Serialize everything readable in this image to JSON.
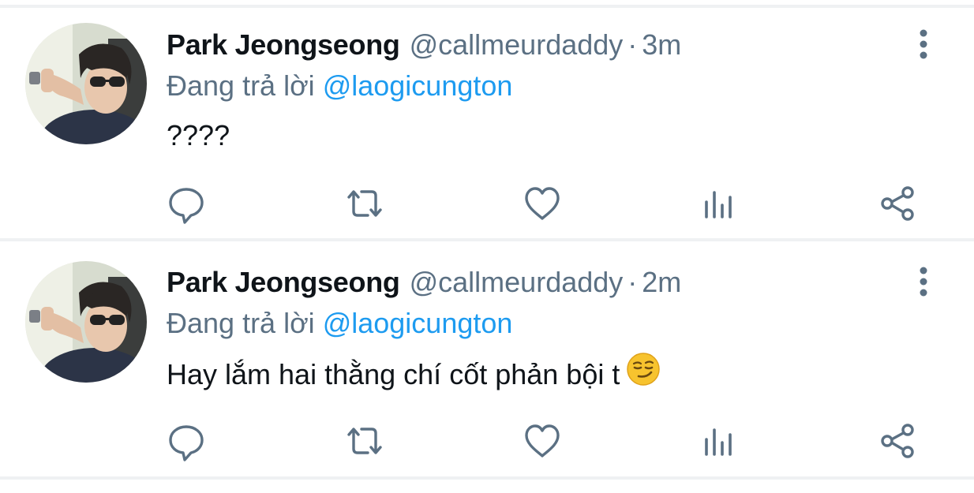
{
  "tweets": [
    {
      "author_name": "Park Jeongseong",
      "author_handle": "@callmeurdaddy",
      "separator": "·",
      "time": "3m",
      "reply_prefix": "Đang trả lời",
      "reply_to": "@laogicungton",
      "text": "????",
      "emoji": "",
      "icons": {
        "menu": "more-vertical-icon",
        "reply": "reply-icon",
        "retweet": "retweet-icon",
        "like": "heart-icon",
        "analytics": "analytics-icon",
        "share": "share-icon"
      }
    },
    {
      "author_name": "Park Jeongseong",
      "author_handle": "@callmeurdaddy",
      "separator": "·",
      "time": "2m",
      "reply_prefix": "Đang trả lời",
      "reply_to": "@laogicungton",
      "text": "Hay lắm hai thằng chí cốt phản bội t",
      "emoji": "smirking-face",
      "icons": {
        "menu": "more-vertical-icon",
        "reply": "reply-icon",
        "retweet": "retweet-icon",
        "like": "heart-icon",
        "analytics": "analytics-icon",
        "share": "share-icon"
      }
    }
  ],
  "colors": {
    "name": "#0f1419",
    "secondary": "#5b7083",
    "mention": "#1d9bf0",
    "icon": "#5b7083",
    "divider": "#eff1f3",
    "emoji_face": "#f7c32e"
  }
}
